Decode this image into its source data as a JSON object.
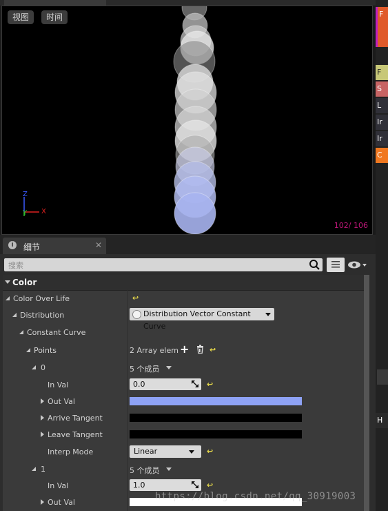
{
  "viewport": {
    "btn_view": "视图",
    "btn_time": "时间",
    "frame_counter": "102/ 106",
    "axis": {
      "z": "Z",
      "y": "Y",
      "x": "X"
    }
  },
  "right_panel": {
    "items": [
      {
        "label": "F",
        "color": "#e05a2a"
      },
      {
        "label": "F",
        "color": "#c8c878"
      },
      {
        "label": "S",
        "color": "#c86464"
      },
      {
        "label": "L",
        "color": "#303038"
      },
      {
        "label": "Ir",
        "color": "#303038"
      },
      {
        "label": "Ir",
        "color": "#303038"
      },
      {
        "label": "C",
        "color": "#f07820"
      }
    ],
    "bottom_label": "H"
  },
  "details": {
    "tab_label": "细节",
    "tab_icon": "info-icon",
    "close_glyph": "✕",
    "search_placeholder": "搜索",
    "section_title": "Color",
    "rows": {
      "color_over_life": "Color Over Life",
      "distribution": "Distribution",
      "distribution_value": "Distribution Vector Constant Curve",
      "constant_curve": "Constant Curve",
      "points": "Points",
      "points_value": "2 Array elem",
      "idx0": "0",
      "members": "5 个成员",
      "in_val": "In Val",
      "in_val_0": "0.0",
      "out_val": "Out Val",
      "arrive_tangent": "Arrive Tangent",
      "leave_tangent": "Leave Tangent",
      "interp_mode": "Interp Mode",
      "interp_value": "Linear",
      "idx1": "1",
      "in_val_1": "1.0"
    },
    "colors": {
      "out_val_0": "#8ea2f5",
      "arrive_tangent_0": "#000000",
      "leave_tangent_0": "#000000",
      "out_val_1": "#ffffff"
    },
    "reset_glyph": "↩"
  },
  "watermark": "https://blog.csdn.net/qq_30919003"
}
